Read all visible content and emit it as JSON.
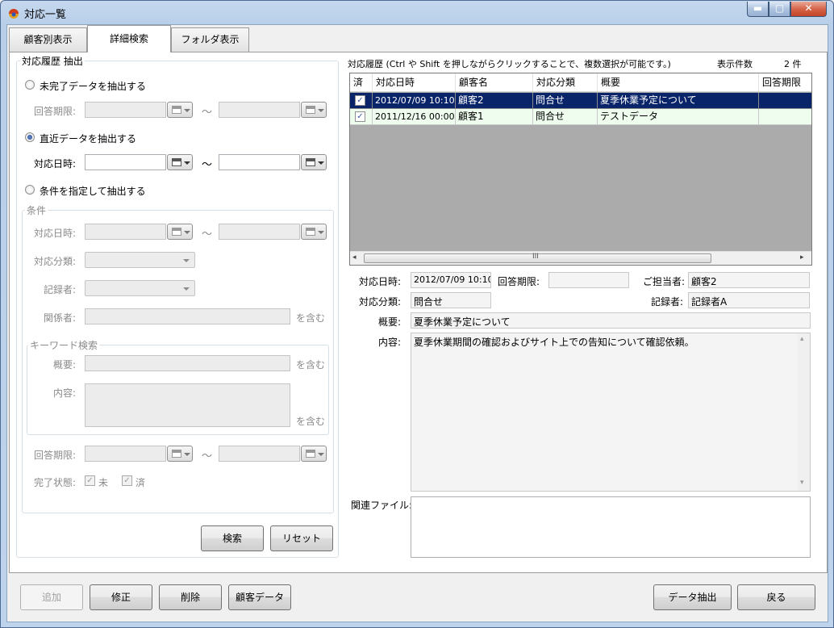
{
  "window": {
    "title": "対応一覧",
    "minimize": "▬",
    "maximize": "▢",
    "close": "✕"
  },
  "tabs": [
    {
      "label": "顧客別表示",
      "active": false
    },
    {
      "label": "詳細検索",
      "active": true
    },
    {
      "label": "フォルダ表示",
      "active": false
    }
  ],
  "left": {
    "group_title": "対応履歴 抽出",
    "radio_incomplete": "未完了データを抽出する",
    "answer_deadline_label": "回答期限:",
    "radio_recent": "直近データを抽出する",
    "response_date_label": "対応日時:",
    "radio_condition": "条件を指定して抽出する",
    "tilde": "～",
    "condition": {
      "title": "条件",
      "date_label": "対応日時:",
      "category_label": "対応分類:",
      "recorder_label": "記録者:",
      "related_label": "関係者:",
      "contains": "を含む",
      "keyword": {
        "title": "キーワード検索",
        "summary_label": "概要:",
        "content_label": "内容:",
        "contains": "を含む"
      }
    },
    "answer_deadline2_label": "回答期限:",
    "status_label": "完了状態:",
    "status_incomplete": "未",
    "status_done": "済",
    "search_button": "検索",
    "reset_button": "リセット"
  },
  "right": {
    "history_label": "対応履歴 (Ctrl や Shift を押しながらクリックすることで、複数選択が可能です。)",
    "count_label": "表示件数",
    "count_value": "2 件",
    "columns": [
      "済",
      "対応日時",
      "顧客名",
      "対応分類",
      "概要",
      "回答期限"
    ],
    "rows": [
      {
        "done": true,
        "date": "2012/07/09 10:10",
        "customer": "顧客2",
        "category": "問合せ",
        "summary": "夏季休業予定について",
        "deadline": ""
      },
      {
        "done": true,
        "date": "2011/12/16 00:00",
        "customer": "顧客1",
        "category": "問合せ",
        "summary": "テストデータ",
        "deadline": ""
      }
    ],
    "scroll_grip": "III",
    "detail": {
      "date_label": "対応日時:",
      "date_value": "2012/07/09 10:10",
      "deadline_label": "回答期限:",
      "deadline_value": "",
      "owner_label": "ご担当者:",
      "owner_value": "顧客2",
      "category_label": "対応分類:",
      "category_value": "問合せ",
      "recorder_label": "記録者:",
      "recorder_value": "記録者A",
      "summary_label": "概要:",
      "summary_value": "夏季休業予定について",
      "content_label": "内容:",
      "content_value": "夏季休業期間の確認およびサイト上での告知について確認依頼。",
      "files_label": "関連ファイル:"
    }
  },
  "bottom": {
    "add": "追加",
    "edit": "修正",
    "delete": "削除",
    "customer_data": "顧客データ",
    "extract": "データ抽出",
    "back": "戻る"
  }
}
